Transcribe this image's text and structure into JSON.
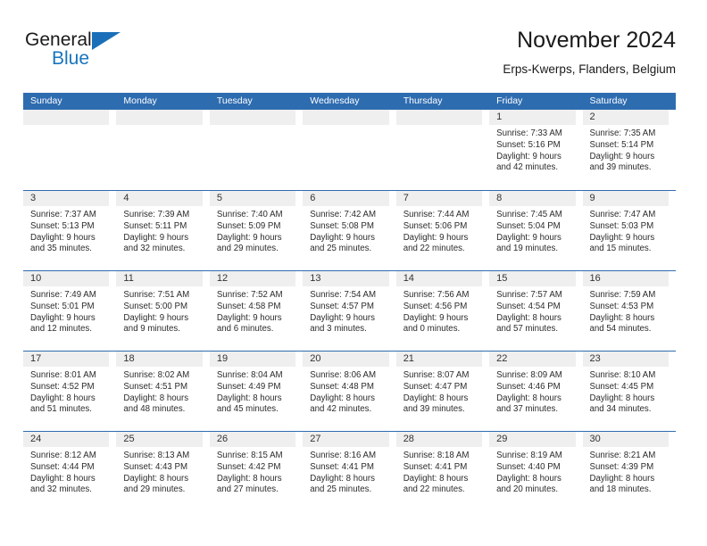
{
  "logo": {
    "word_one": "General",
    "word_two": "Blue",
    "triangle_icon": "triangle-icon",
    "accent_color": "#1874bd"
  },
  "header": {
    "title": "November 2024",
    "subtitle": "Erps-Kwerps, Flanders, Belgium"
  },
  "theme": {
    "header_blue": "#2e6cb0",
    "day_band_gray": "#efefef",
    "text_dark": "#2b2b2b"
  },
  "calendar": {
    "day_names": [
      "Sunday",
      "Monday",
      "Tuesday",
      "Wednesday",
      "Thursday",
      "Friday",
      "Saturday"
    ],
    "weeks": [
      [
        {
          "day": "",
          "lines": []
        },
        {
          "day": "",
          "lines": []
        },
        {
          "day": "",
          "lines": []
        },
        {
          "day": "",
          "lines": []
        },
        {
          "day": "",
          "lines": []
        },
        {
          "day": "1",
          "lines": [
            "Sunrise: 7:33 AM",
            "Sunset: 5:16 PM",
            "Daylight: 9 hours",
            "and 42 minutes."
          ]
        },
        {
          "day": "2",
          "lines": [
            "Sunrise: 7:35 AM",
            "Sunset: 5:14 PM",
            "Daylight: 9 hours",
            "and 39 minutes."
          ]
        }
      ],
      [
        {
          "day": "3",
          "lines": [
            "Sunrise: 7:37 AM",
            "Sunset: 5:13 PM",
            "Daylight: 9 hours",
            "and 35 minutes."
          ]
        },
        {
          "day": "4",
          "lines": [
            "Sunrise: 7:39 AM",
            "Sunset: 5:11 PM",
            "Daylight: 9 hours",
            "and 32 minutes."
          ]
        },
        {
          "day": "5",
          "lines": [
            "Sunrise: 7:40 AM",
            "Sunset: 5:09 PM",
            "Daylight: 9 hours",
            "and 29 minutes."
          ]
        },
        {
          "day": "6",
          "lines": [
            "Sunrise: 7:42 AM",
            "Sunset: 5:08 PM",
            "Daylight: 9 hours",
            "and 25 minutes."
          ]
        },
        {
          "day": "7",
          "lines": [
            "Sunrise: 7:44 AM",
            "Sunset: 5:06 PM",
            "Daylight: 9 hours",
            "and 22 minutes."
          ]
        },
        {
          "day": "8",
          "lines": [
            "Sunrise: 7:45 AM",
            "Sunset: 5:04 PM",
            "Daylight: 9 hours",
            "and 19 minutes."
          ]
        },
        {
          "day": "9",
          "lines": [
            "Sunrise: 7:47 AM",
            "Sunset: 5:03 PM",
            "Daylight: 9 hours",
            "and 15 minutes."
          ]
        }
      ],
      [
        {
          "day": "10",
          "lines": [
            "Sunrise: 7:49 AM",
            "Sunset: 5:01 PM",
            "Daylight: 9 hours",
            "and 12 minutes."
          ]
        },
        {
          "day": "11",
          "lines": [
            "Sunrise: 7:51 AM",
            "Sunset: 5:00 PM",
            "Daylight: 9 hours",
            "and 9 minutes."
          ]
        },
        {
          "day": "12",
          "lines": [
            "Sunrise: 7:52 AM",
            "Sunset: 4:58 PM",
            "Daylight: 9 hours",
            "and 6 minutes."
          ]
        },
        {
          "day": "13",
          "lines": [
            "Sunrise: 7:54 AM",
            "Sunset: 4:57 PM",
            "Daylight: 9 hours",
            "and 3 minutes."
          ]
        },
        {
          "day": "14",
          "lines": [
            "Sunrise: 7:56 AM",
            "Sunset: 4:56 PM",
            "Daylight: 9 hours",
            "and 0 minutes."
          ]
        },
        {
          "day": "15",
          "lines": [
            "Sunrise: 7:57 AM",
            "Sunset: 4:54 PM",
            "Daylight: 8 hours",
            "and 57 minutes."
          ]
        },
        {
          "day": "16",
          "lines": [
            "Sunrise: 7:59 AM",
            "Sunset: 4:53 PM",
            "Daylight: 8 hours",
            "and 54 minutes."
          ]
        }
      ],
      [
        {
          "day": "17",
          "lines": [
            "Sunrise: 8:01 AM",
            "Sunset: 4:52 PM",
            "Daylight: 8 hours",
            "and 51 minutes."
          ]
        },
        {
          "day": "18",
          "lines": [
            "Sunrise: 8:02 AM",
            "Sunset: 4:51 PM",
            "Daylight: 8 hours",
            "and 48 minutes."
          ]
        },
        {
          "day": "19",
          "lines": [
            "Sunrise: 8:04 AM",
            "Sunset: 4:49 PM",
            "Daylight: 8 hours",
            "and 45 minutes."
          ]
        },
        {
          "day": "20",
          "lines": [
            "Sunrise: 8:06 AM",
            "Sunset: 4:48 PM",
            "Daylight: 8 hours",
            "and 42 minutes."
          ]
        },
        {
          "day": "21",
          "lines": [
            "Sunrise: 8:07 AM",
            "Sunset: 4:47 PM",
            "Daylight: 8 hours",
            "and 39 minutes."
          ]
        },
        {
          "day": "22",
          "lines": [
            "Sunrise: 8:09 AM",
            "Sunset: 4:46 PM",
            "Daylight: 8 hours",
            "and 37 minutes."
          ]
        },
        {
          "day": "23",
          "lines": [
            "Sunrise: 8:10 AM",
            "Sunset: 4:45 PM",
            "Daylight: 8 hours",
            "and 34 minutes."
          ]
        }
      ],
      [
        {
          "day": "24",
          "lines": [
            "Sunrise: 8:12 AM",
            "Sunset: 4:44 PM",
            "Daylight: 8 hours",
            "and 32 minutes."
          ]
        },
        {
          "day": "25",
          "lines": [
            "Sunrise: 8:13 AM",
            "Sunset: 4:43 PM",
            "Daylight: 8 hours",
            "and 29 minutes."
          ]
        },
        {
          "day": "26",
          "lines": [
            "Sunrise: 8:15 AM",
            "Sunset: 4:42 PM",
            "Daylight: 8 hours",
            "and 27 minutes."
          ]
        },
        {
          "day": "27",
          "lines": [
            "Sunrise: 8:16 AM",
            "Sunset: 4:41 PM",
            "Daylight: 8 hours",
            "and 25 minutes."
          ]
        },
        {
          "day": "28",
          "lines": [
            "Sunrise: 8:18 AM",
            "Sunset: 4:41 PM",
            "Daylight: 8 hours",
            "and 22 minutes."
          ]
        },
        {
          "day": "29",
          "lines": [
            "Sunrise: 8:19 AM",
            "Sunset: 4:40 PM",
            "Daylight: 8 hours",
            "and 20 minutes."
          ]
        },
        {
          "day": "30",
          "lines": [
            "Sunrise: 8:21 AM",
            "Sunset: 4:39 PM",
            "Daylight: 8 hours",
            "and 18 minutes."
          ]
        }
      ]
    ]
  }
}
